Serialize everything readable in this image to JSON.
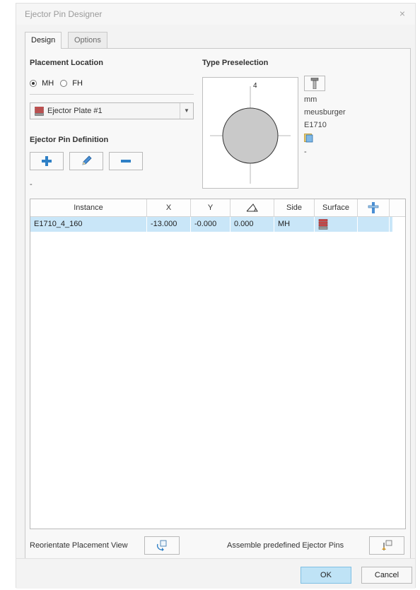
{
  "window": {
    "title": "Ejector Pin Designer",
    "close_glyph": "×"
  },
  "tabs": [
    {
      "label": "Design",
      "active": true
    },
    {
      "label": "Options",
      "active": false
    }
  ],
  "placement": {
    "heading": "Placement Location",
    "options": [
      {
        "label": "MH",
        "checked": true
      },
      {
        "label": "FH",
        "checked": false
      }
    ],
    "plate_select": {
      "value": "Ejector Plate #1",
      "icon": "plate-icon"
    }
  },
  "definition": {
    "heading": "Ejector Pin Definition",
    "buttons": [
      {
        "name": "add",
        "icon": "plus-icon"
      },
      {
        "name": "edit",
        "icon": "pencil-icon"
      },
      {
        "name": "remove",
        "icon": "minus-icon"
      }
    ],
    "status": "-"
  },
  "type_preselection": {
    "heading": "Type Preselection",
    "diameter_label": "4",
    "unit": "mm",
    "vendor": "meusburger",
    "part": "E1710",
    "extra": "-",
    "select_icon": "pin-select-icon",
    "catalog_icon": "catalog-icon"
  },
  "table": {
    "columns": [
      "Instance",
      "X",
      "Y",
      "angle-icon",
      "Side",
      "Surface",
      "pin-column-icon"
    ],
    "rows": [
      {
        "instance": "E1710_4_160",
        "x": "-13.000",
        "y": "-0.000",
        "angle": "0.000",
        "side": "MH",
        "surface": "surface-icon"
      }
    ]
  },
  "footer": {
    "reorientate_label": "Reorientate Placement View",
    "assemble_label": "Assemble predefined Ejector Pins"
  },
  "buttons": {
    "ok": "OK",
    "cancel": "Cancel"
  },
  "colors": {
    "selection": "#c9e6f8",
    "ok_button": "#bfe3f6",
    "accent_blue": "#2f80c6"
  }
}
